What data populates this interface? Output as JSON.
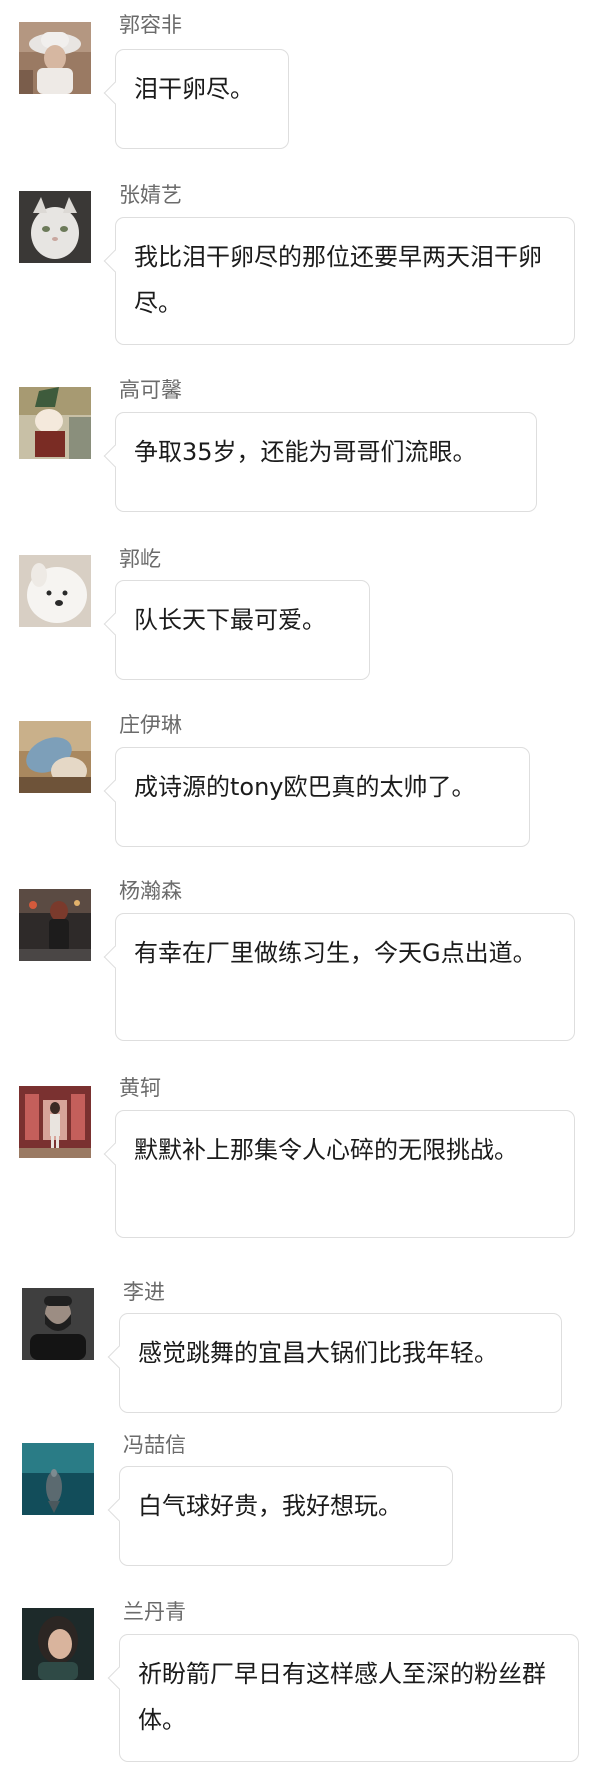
{
  "messages": [
    {
      "name": "郭容非",
      "text": "泪干卵尽。",
      "avatar_icon": "woman-in-white-hat-avatar"
    },
    {
      "name": "张婧艺",
      "text": "我比泪干卵尽的那位还要早两天泪干卵尽。",
      "avatar_icon": "white-cat-avatar"
    },
    {
      "name": "高可馨",
      "text": "争取35岁，还能为哥哥们流眼。",
      "avatar_icon": "cartoon-character-avatar"
    },
    {
      "name": "郭屹",
      "text": "队长天下最可爱。",
      "avatar_icon": "white-dog-avatar"
    },
    {
      "name": "庄伊琳",
      "text": "成诗源的tony欧巴真的太帅了。",
      "avatar_icon": "blurred-photo-avatar"
    },
    {
      "name": "杨瀚森",
      "text": "有幸在厂里做练习生，今天G点出道。",
      "avatar_icon": "street-scene-avatar"
    },
    {
      "name": "黄轲",
      "text": "默默补上那集令人心碎的无限挑战。",
      "avatar_icon": "person-standing-avatar"
    },
    {
      "name": "李进",
      "text": "感觉跳舞的宜昌大锅们比我年轻。",
      "avatar_icon": "bearded-man-avatar"
    },
    {
      "name": "冯喆信",
      "text": "白气球好贵，我好想玩。",
      "avatar_icon": "dolphin-underwater-avatar"
    },
    {
      "name": "兰丹青",
      "text": "祈盼箭厂早日有这样感人至深的粉丝群体。",
      "avatar_icon": "woman-portrait-avatar"
    }
  ]
}
